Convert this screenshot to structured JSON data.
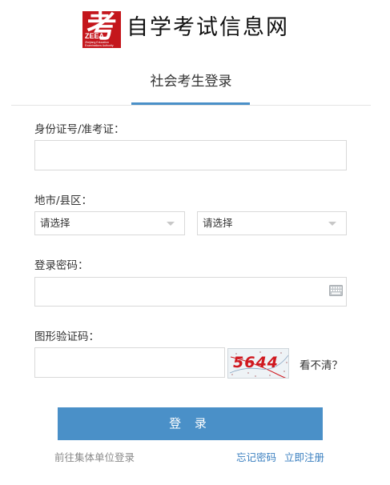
{
  "header": {
    "logo_char": "考",
    "logo_abbr": "ZEEA",
    "logo_line1": "Zhejiang Education",
    "logo_line2": "Examinations Authority",
    "site_title": "自学考试信息网"
  },
  "tab": {
    "label": "社会考生登录"
  },
  "form": {
    "id_label": "身份证号/准考证：",
    "id_value": "",
    "region_label": "地市/县区：",
    "city_select": "请选择",
    "county_select": "请选择",
    "password_label": "登录密码：",
    "password_value": "",
    "captcha_label": "图形验证码：",
    "captcha_value": "",
    "captcha_image_text": "5644",
    "refresh_captcha": "看不清？"
  },
  "actions": {
    "login_button": "登 录",
    "group_login": "前往集体单位登录",
    "forgot_password": "忘记密码",
    "register": "立即注册"
  },
  "colors": {
    "accent": "#4a90c8",
    "logo_red": "#c4161c",
    "captcha_red": "#d0181f"
  }
}
